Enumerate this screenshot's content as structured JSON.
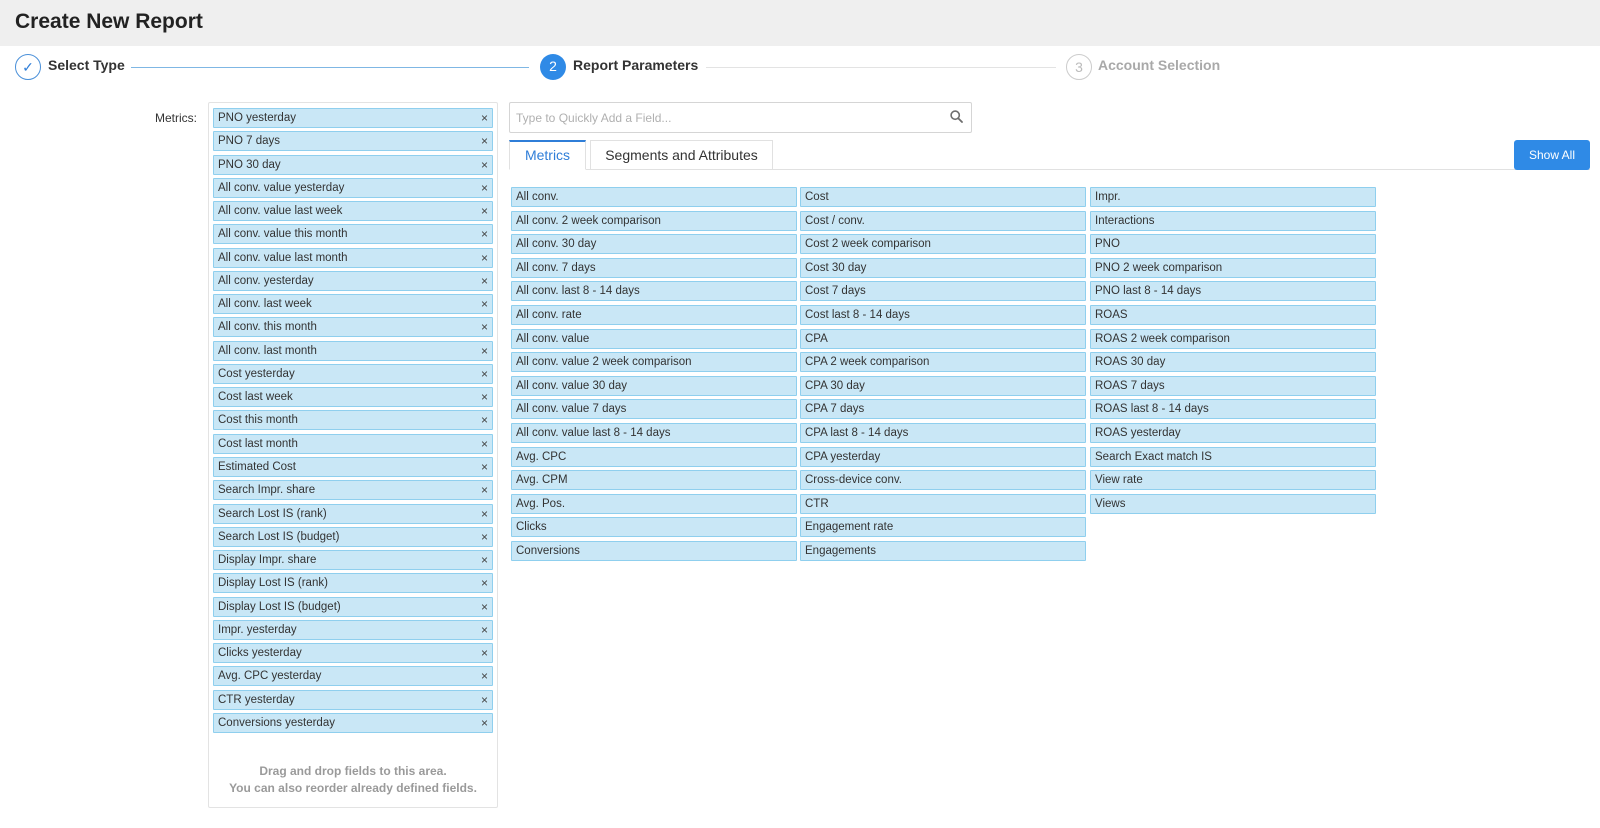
{
  "header": {
    "title": "Create New Report"
  },
  "steps": [
    {
      "number": "✓",
      "label": "Select Type"
    },
    {
      "number": "2",
      "label": "Report Parameters"
    },
    {
      "number": "3",
      "label": "Account Selection"
    }
  ],
  "metrics_panel": {
    "label": "Metrics:",
    "remove_glyph": "×",
    "selected": [
      "PNO yesterday",
      "PNO 7 days",
      "PNO 30 day",
      "All conv. value yesterday",
      "All conv. value last week",
      "All conv. value this month",
      "All conv. value last month",
      "All conv. yesterday",
      "All conv. last week",
      "All conv. this month",
      "All conv. last month",
      "Cost yesterday",
      "Cost last week",
      "Cost this month",
      "Cost last month",
      "Estimated Cost",
      "Search Impr. share",
      "Search Lost IS (rank)",
      "Search Lost IS (budget)",
      "Display Impr. share",
      "Display Lost IS (rank)",
      "Display Lost IS (budget)",
      "Impr. yesterday",
      "Clicks yesterday",
      "Avg. CPC yesterday",
      "CTR yesterday",
      "Conversions yesterday"
    ],
    "hint_line1": "Drag and drop fields to this area.",
    "hint_line2": "You can also reorder already defined fields."
  },
  "search": {
    "placeholder": "Type to Quickly Add a Field...",
    "value": "",
    "icon": "search-icon"
  },
  "tabs": [
    {
      "label": "Metrics",
      "active": true
    },
    {
      "label": "Segments and Attributes",
      "active": false
    }
  ],
  "show_all_label": "Show All",
  "available_fields": [
    [
      "All conv.",
      "All conv. 2 week comparison",
      "All conv. 30 day",
      "All conv. 7 days",
      "All conv. last 8 - 14 days",
      "All conv. rate",
      "All conv. value",
      "All conv. value 2 week comparison",
      "All conv. value 30 day",
      "All conv. value 7 days",
      "All conv. value last 8 - 14 days",
      "Avg. CPC",
      "Avg. CPM",
      "Avg. Pos.",
      "Clicks",
      "Conversions"
    ],
    [
      "Cost",
      "Cost / conv.",
      "Cost 2 week comparison",
      "Cost 30 day",
      "Cost 7 days",
      "Cost last 8 - 14 days",
      "CPA",
      "CPA 2 week comparison",
      "CPA 30 day",
      "CPA 7 days",
      "CPA last 8 - 14 days",
      "CPA yesterday",
      "Cross-device conv.",
      "CTR",
      "Engagement rate",
      "Engagements"
    ],
    [
      "Impr.",
      "Interactions",
      "PNO",
      "PNO 2 week comparison",
      "PNO last 8 - 14 days",
      "ROAS",
      "ROAS 2 week comparison",
      "ROAS 30 day",
      "ROAS 7 days",
      "ROAS last 8 - 14 days",
      "ROAS yesterday",
      "Search Exact match IS",
      "View rate",
      "Views"
    ]
  ],
  "colors": {
    "accent": "#2f8ae6",
    "chip_fill": "#c9e7f6",
    "chip_border": "#8fcfee",
    "header_bg": "#efefef"
  }
}
